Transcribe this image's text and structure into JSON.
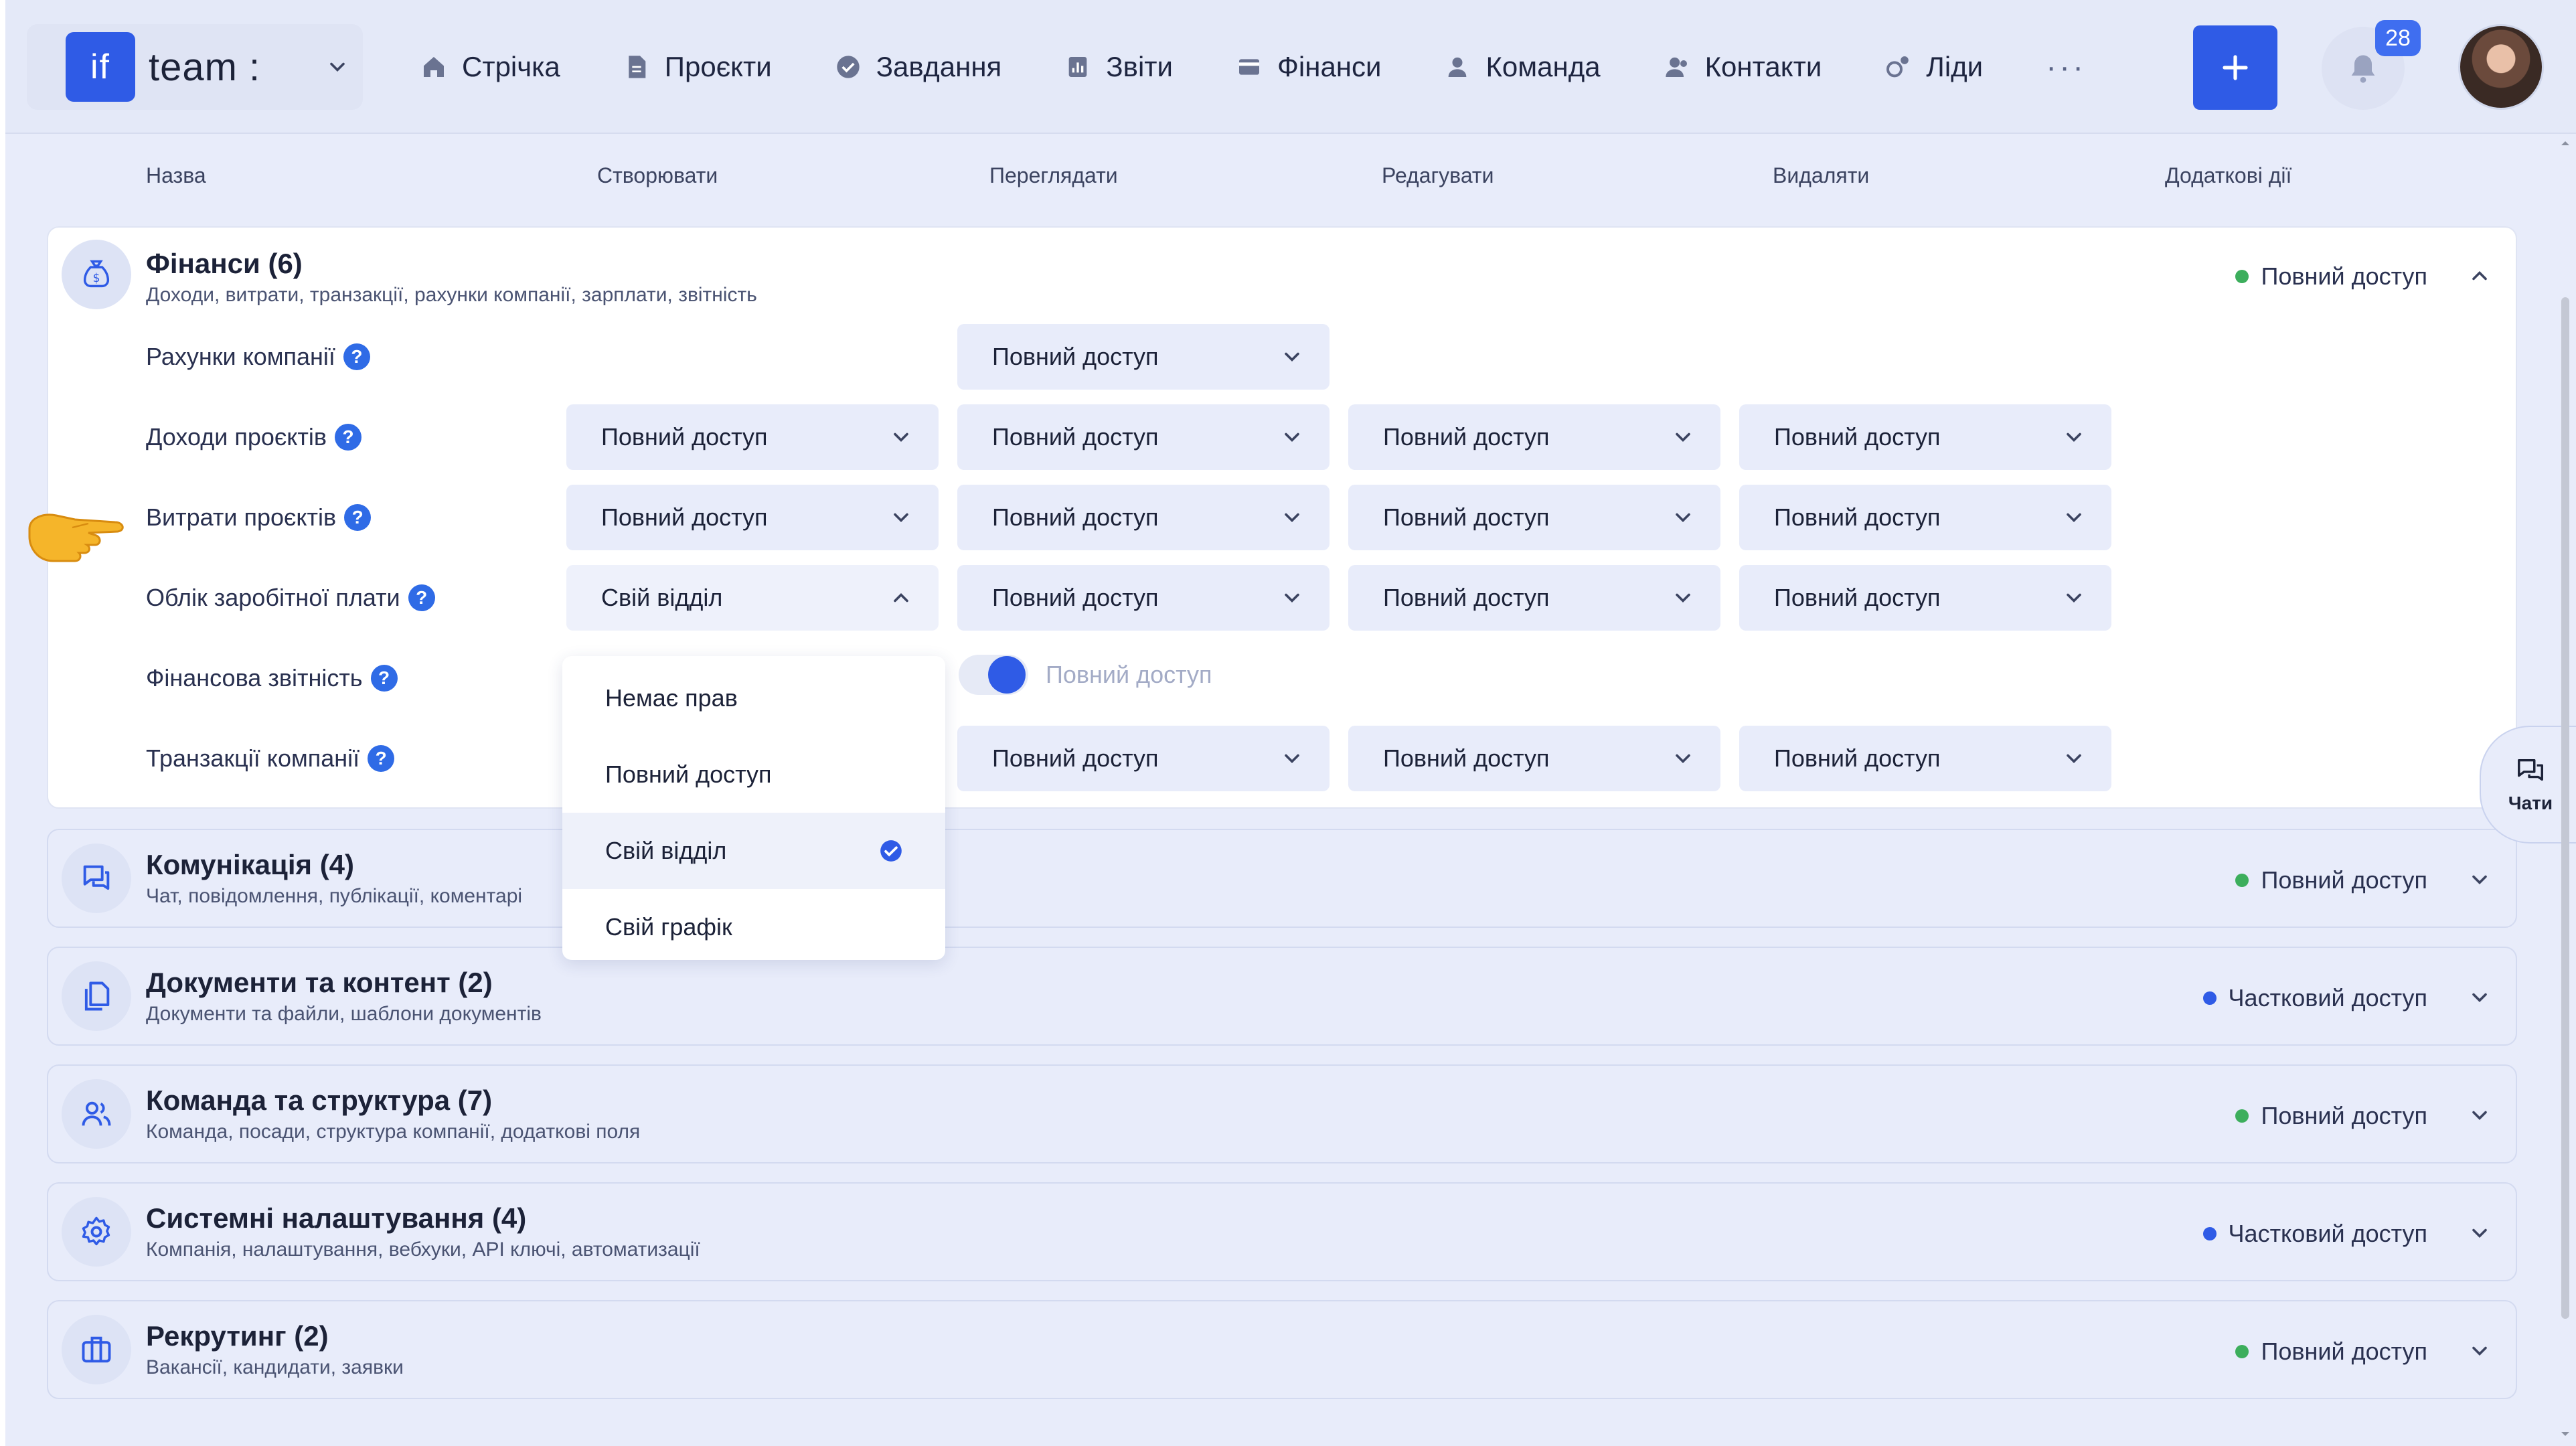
{
  "header": {
    "logo_text": "if",
    "team_name": "team :",
    "nav": [
      {
        "label": "Стрічка",
        "icon": "home-icon"
      },
      {
        "label": "Проєкти",
        "icon": "document-icon"
      },
      {
        "label": "Завдання",
        "icon": "check-circle-icon"
      },
      {
        "label": "Звіти",
        "icon": "report-icon"
      },
      {
        "label": "Фінанси",
        "icon": "wallet-icon"
      },
      {
        "label": "Команда",
        "icon": "person-icon"
      },
      {
        "label": "Контакти",
        "icon": "contacts-icon"
      },
      {
        "label": "Ліди",
        "icon": "leads-icon"
      }
    ],
    "more": "···",
    "add": "+",
    "notifications": "28"
  },
  "columns": [
    "Назва",
    "Створювати",
    "Переглядати",
    "Редагувати",
    "Видаляти",
    "Додаткові дії"
  ],
  "finance": {
    "title": "Фінанси (6)",
    "subtitle": "Доходи, витрати, транзакції, рахунки компанії, зарплати, звітність",
    "status": "Повний доступ",
    "rows": [
      {
        "label": "Рахунки компанії",
        "view": "Повний доступ"
      },
      {
        "label": "Доходи проєктів",
        "create": "Повний доступ",
        "view": "Повний доступ",
        "edit": "Повний доступ",
        "delete": "Повний доступ"
      },
      {
        "label": "Витрати проєктів",
        "create": "Повний доступ",
        "view": "Повний доступ",
        "edit": "Повний доступ",
        "delete": "Повний доступ"
      },
      {
        "label": "Облік заробітної плати",
        "create": "Свій відділ",
        "view": "Повний доступ",
        "edit": "Повний доступ",
        "delete": "Повний доступ"
      },
      {
        "label": "Фінансова звітність",
        "view_toggle": "Повний доступ"
      },
      {
        "label": "Транзакції компанії",
        "view": "Повний доступ",
        "edit": "Повний доступ",
        "delete": "Повний доступ"
      }
    ]
  },
  "dropdown": {
    "options": [
      "Немає прав",
      "Повний доступ",
      "Свій відділ",
      "Свій графік"
    ],
    "selected_index": 2
  },
  "sections": [
    {
      "title": "Комунікація (4)",
      "subtitle": "Чат, повідомлення, публікації, коментарі",
      "status": "Повний доступ",
      "status_color": "#3cae5c",
      "icon": "chat-icon"
    },
    {
      "title": "Документи та контент (2)",
      "subtitle": "Документи та файли, шаблони документів",
      "status": "Частковий доступ",
      "status_color": "#2f5be6",
      "icon": "documents-icon"
    },
    {
      "title": "Команда та структура (7)",
      "subtitle": "Команда, посади, структура компанії, додаткові поля",
      "status": "Повний доступ",
      "status_color": "#3cae5c",
      "icon": "team-icon"
    },
    {
      "title": "Системні налаштування (4)",
      "subtitle": "Компанія, налаштування, вебхуки, API ключі, автоматизації",
      "status": "Частковий доступ",
      "status_color": "#2f5be6",
      "icon": "settings-icon"
    },
    {
      "title": "Рекрутинг (2)",
      "subtitle": "Вакансії, кандидати, заявки",
      "status": "Повний доступ",
      "status_color": "#3cae5c",
      "icon": "briefcase-icon"
    }
  ],
  "chat_button": "Чати",
  "colors": {
    "accent": "#2f5be6",
    "full_access": "#3cae5c",
    "partial_access": "#2f5be6"
  }
}
